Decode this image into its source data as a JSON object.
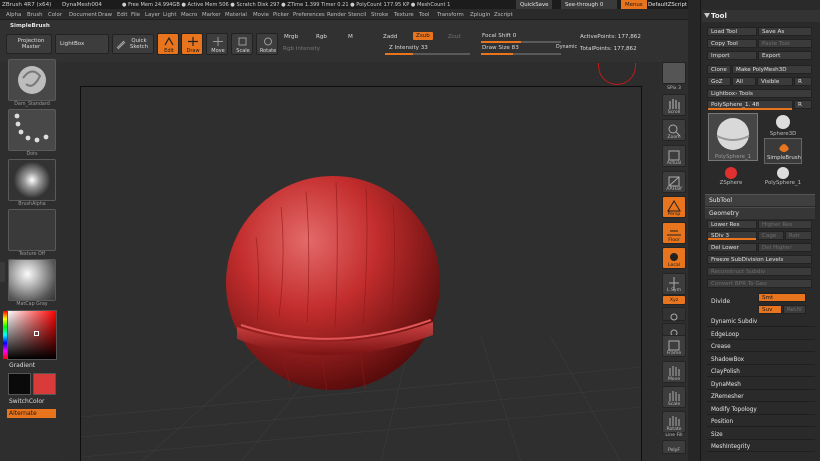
{
  "titlebar": {
    "app": "ZBrush 4R7 (x64)",
    "doc": "DynaMesh004",
    "mem": "● Free Mem 24.994GB ● Active Mem 506 ● Scratch Disk 297 ● ZTime 1.399 Timer 0.21 ● PolyCount 177.95 KP ● MeshCount 1",
    "quicksave": "QuickSave",
    "seethrough": "See-through 0",
    "menus": "Menus",
    "script": "DefaultZScript"
  },
  "menu": [
    "Alpha",
    "Brush",
    "Color",
    "Document",
    "Draw",
    "Edit",
    "File",
    "Layer",
    "Light",
    "Macro",
    "Marker",
    "Material",
    "Movie",
    "Picker",
    "Preferences",
    "Render",
    "Stencil",
    "Stroke",
    "Texture",
    "Tool",
    "Transform",
    "Zplugin",
    "Zscript"
  ],
  "shelf": {
    "brush": "SimpleBrush",
    "projection": "Projection Master",
    "lightbox": "LightBox",
    "quicksketch": "Quick Sketch",
    "edit": "Edit",
    "draw": "Draw",
    "move": "Move",
    "scale": "Scale",
    "rotate": "Rotate",
    "mrgb": "Mrgb",
    "rgb": "Rgb",
    "m": "M",
    "rgb_int": "Rgb Intensity",
    "zadd": "Zadd",
    "zsub": "Zsub",
    "zcut": "Zcut",
    "z_int": "Z Intensity 33",
    "focal": "Focal Shift 0",
    "drawsize": "Draw Size 83",
    "dynamic": "Dynamic",
    "active": "ActivePoints: 177,862",
    "total": "TotalPoints: 177,862"
  },
  "left": {
    "brush_label": "Dam_Standard",
    "stroke_label": "Dots",
    "alpha_label": "BrushAlpha",
    "texture_label": "Texture Off",
    "material_label": "MatCap Gray",
    "gradient": "Gradient",
    "switchcolor": "SwitchColor",
    "alternate": "Alternate",
    "main_color": "#d93a3a"
  },
  "rtools": [
    "SPix 3",
    "Scroll",
    "Zoom",
    "Actual",
    "AAHalf",
    "Persp",
    "Floor",
    "Local",
    "L.Sym",
    "Xyz",
    "",
    "Frame",
    "Move",
    "Scale",
    "Rotate",
    "Line Fill",
    "PolyF"
  ],
  "panel": {
    "title": "Tool",
    "load": "Load Tool",
    "saveas": "Save As",
    "copy": "Copy Tool",
    "paste": "Paste Tool",
    "import": "Import",
    "export": "Export",
    "clone": "Clone",
    "makepm": "Make PolyMesh3D",
    "goz": "GoZ",
    "all": "All",
    "visible": "Visible",
    "r": "R",
    "lightbox_tools": "Lightbox› Tools",
    "current_tool": "PolySphere_1. 48",
    "thumbs": [
      "PolySphere_1",
      "Sphere3D",
      "SimpleBrush",
      "ZSphere",
      "PolySphere_1"
    ],
    "subtool": "SubTool",
    "geometry": "Geometry",
    "lower": "Lower Res",
    "higher": "Higher Res",
    "sdiv": "SDiv 3",
    "cage": "Cage",
    "rstr": "Rstr",
    "dellower": "Del Lower",
    "delhigher": "Del Higher",
    "freeze": "Freeze SubDivision Levels",
    "reconstruct": "Reconstruct Subdiv",
    "convert": "Convert BPR To Geo",
    "divide": "Divide",
    "smt": "Smt",
    "suv": "Suv",
    "reuv": "ReUV",
    "sections": [
      "Dynamic Subdiv",
      "EdgeLoop",
      "Crease",
      "ShadowBox",
      "ClayPolish",
      "DynaMesh",
      "ZRemesher",
      "Modify Topology",
      "Position",
      "Size",
      "MeshIntegrity"
    ]
  }
}
